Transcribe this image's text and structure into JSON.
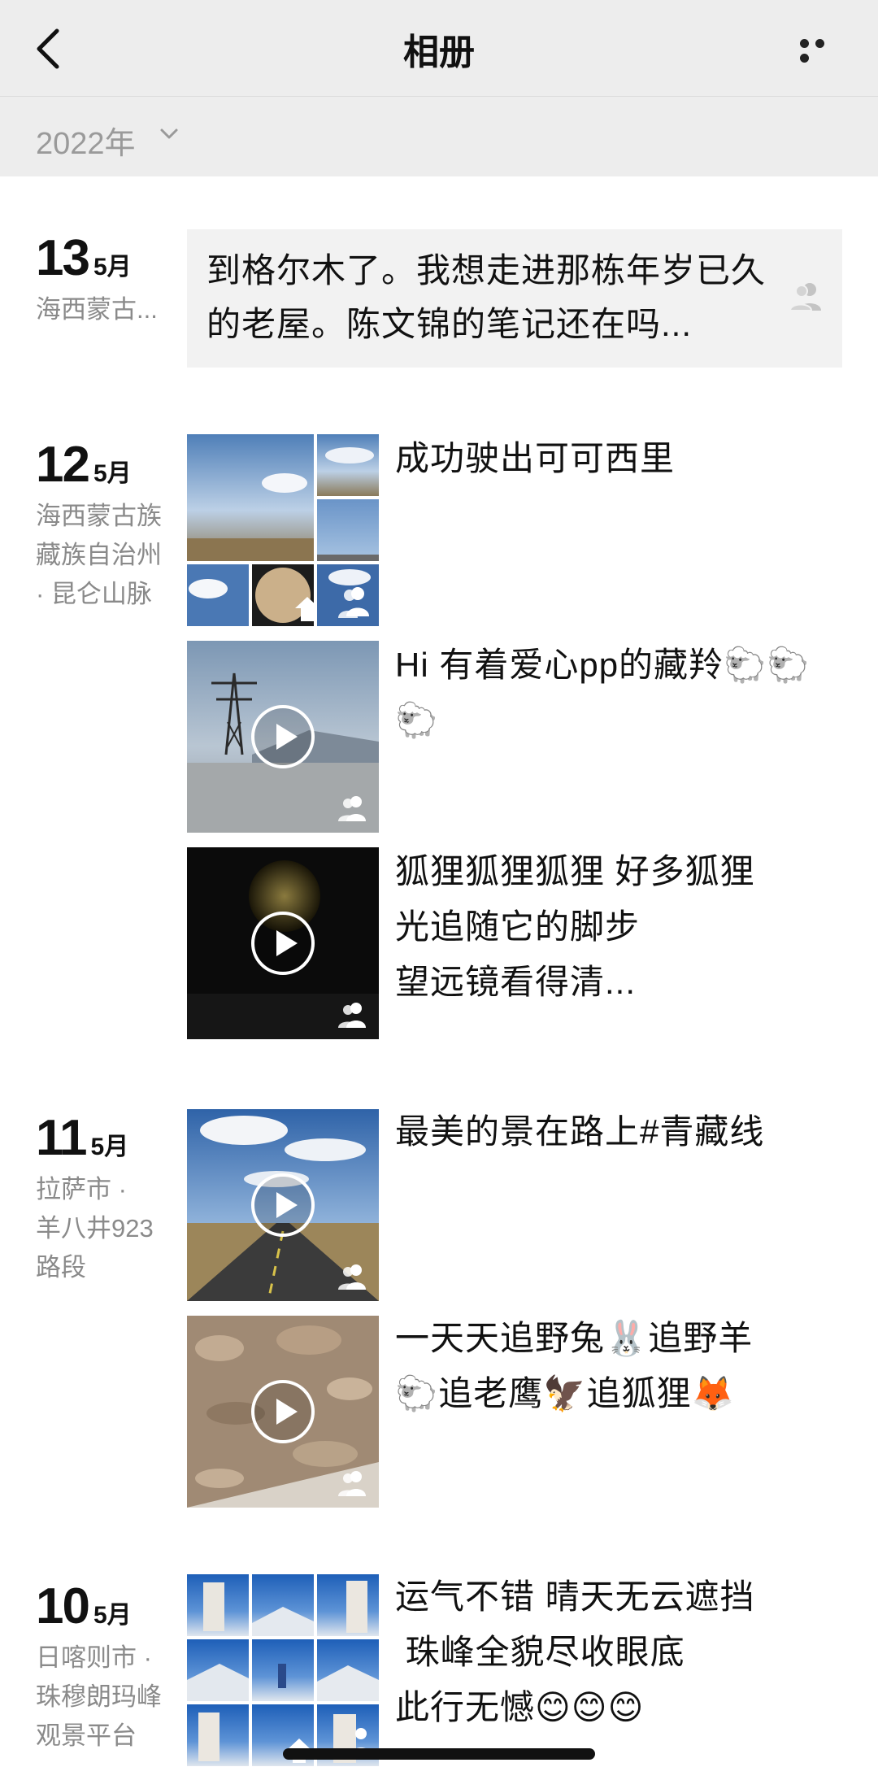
{
  "navbar": {
    "title": "相册"
  },
  "year_selector": {
    "label": "2022年"
  },
  "days": [
    {
      "day": "13",
      "month": "5月",
      "location": "海西蒙古..."
    },
    {
      "day": "12",
      "month": "5月",
      "location": "海西蒙古族\n藏族自治州\n· 昆仑山脉"
    },
    {
      "day": "11",
      "month": "5月",
      "location": "拉萨市 ·\n羊八井923\n路段"
    },
    {
      "day": "10",
      "month": "5月",
      "location": "日喀则市 ·\n珠穆朗玛峰\n观景平台"
    }
  ],
  "posts": {
    "p13": {
      "text": "到格尔木了。我想走进那栋年岁已久的老屋。陈文锦的笔记还在吗..."
    },
    "p12a": {
      "text": "成功驶出可可西里"
    },
    "p12b": {
      "text": "Hi 有着爱心pp的藏羚🐑🐑🐑"
    },
    "p12c": {
      "line1": "狐狸狐狸狐狸 好多狐狸",
      "line2": "光追随它的脚步",
      "line3": "望远镜看得清..."
    },
    "p11a": {
      "text": "最美的景在路上#青藏线"
    },
    "p11b": {
      "line1": "一天天追野兔🐰追野羊",
      "line2": "🐑追老鹰🦅追狐狸🦊"
    },
    "p10a": {
      "line1": "运气不错 晴天无云遮挡",
      "line2": " 珠峰全貌尽收眼底",
      "line3": "此行无憾😊😊😊"
    }
  }
}
